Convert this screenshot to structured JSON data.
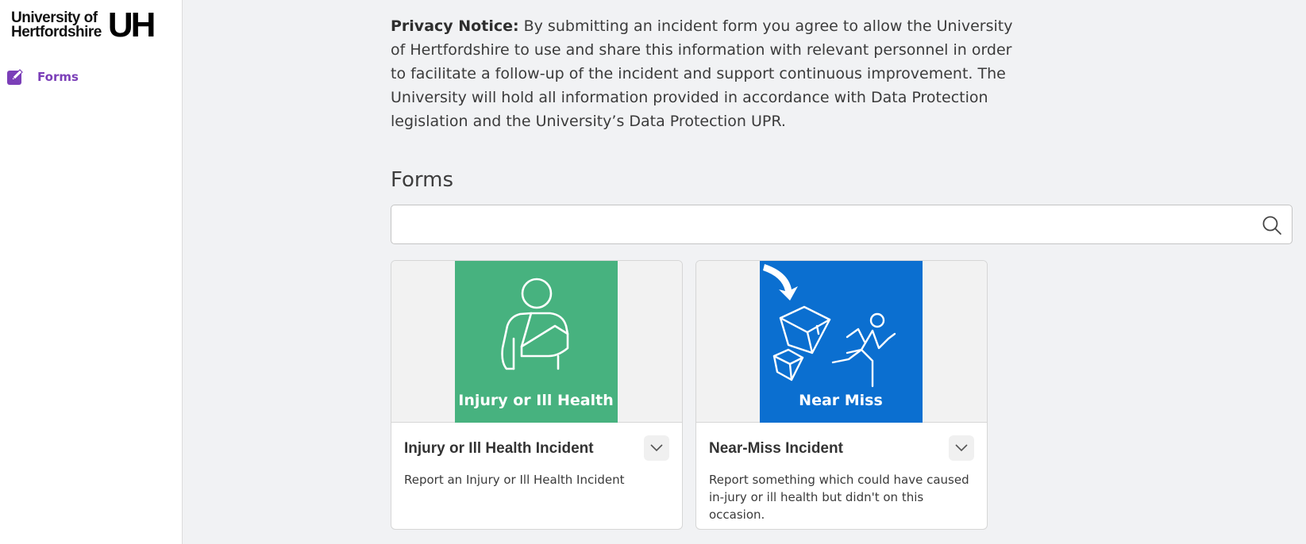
{
  "logo": {
    "text_line1": "University of",
    "text_line2": "Hertfordshire",
    "mark": "UH"
  },
  "sidebar": {
    "items": [
      {
        "label": "Forms",
        "icon": "edit-icon"
      }
    ]
  },
  "notice": {
    "label": "Privacy Notice:",
    "text": " By submitting an incident form you agree to allow the University of Hertfordshire to use and share this information with relevant personnel in order to facilitate a follow-up of the incident and support continuous improvement. The University will hold all information provided in accordance with Data Protection legislation and the University’s Data Protection UPR."
  },
  "forms": {
    "heading": "Forms",
    "search": {
      "value": "",
      "placeholder": ""
    },
    "cards": [
      {
        "banner_text": "Injury or Ill Health",
        "title": "Injury or Ill Health Incident",
        "description": "Report an Injury or Ill Health Incident",
        "banner_color": "#47b27f"
      },
      {
        "banner_text": "Near Miss",
        "title": "Near-Miss Incident",
        "description": "Report something which could have caused in-jury or ill health but didn't on this occasion.",
        "banner_color": "#0b6fd0"
      }
    ]
  },
  "colors": {
    "accent": "#7b3fb8",
    "background": "#f1f2f4"
  }
}
